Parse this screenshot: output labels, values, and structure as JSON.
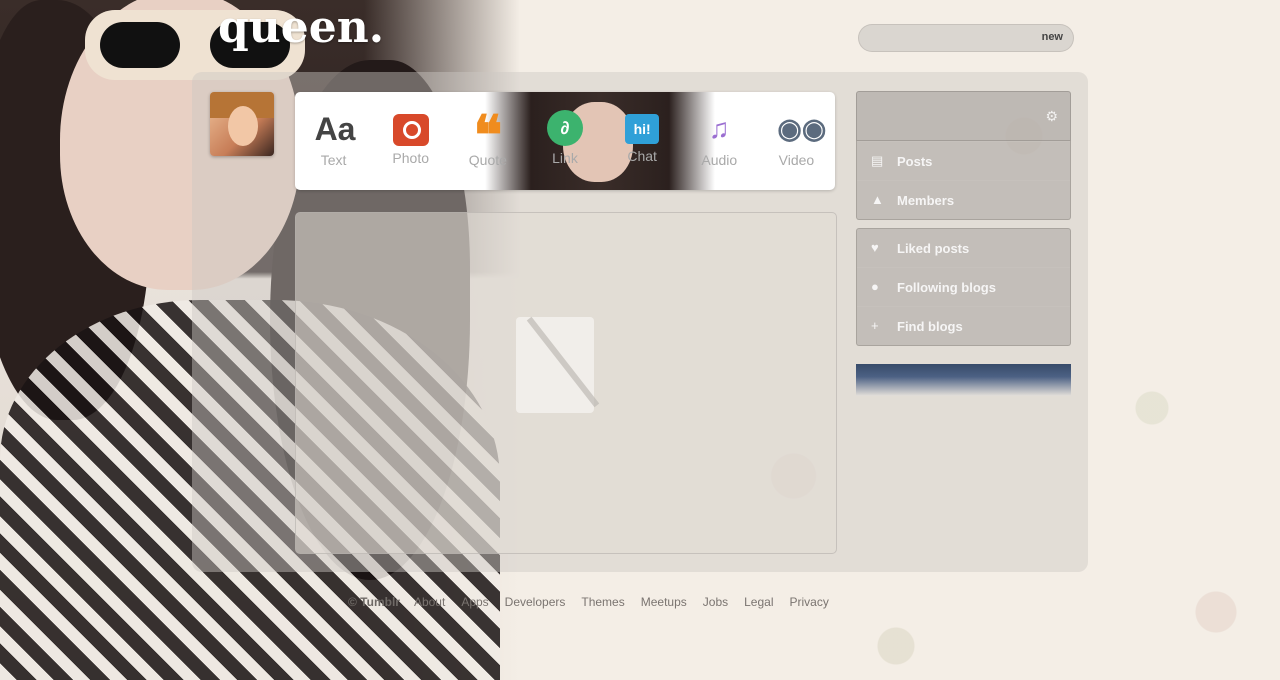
{
  "blog": {
    "title": "queen."
  },
  "search": {
    "placeholder": "",
    "new_label": "new"
  },
  "post_types": [
    {
      "label": "Text",
      "icon": "Aa",
      "icon_name": "text-icon"
    },
    {
      "label": "Photo",
      "icon": "",
      "icon_name": "camera-icon"
    },
    {
      "label": "Quote",
      "icon": "❝",
      "icon_name": "quote-icon"
    },
    {
      "label": "Link",
      "icon": "∂",
      "icon_name": "link-icon"
    },
    {
      "label": "Chat",
      "icon": "hi!",
      "icon_name": "chat-icon"
    },
    {
      "label": "Audio",
      "icon": "♫",
      "icon_name": "headphones-icon"
    },
    {
      "label": "Video",
      "icon": "◉◉",
      "icon_name": "video-camera-icon"
    }
  ],
  "sidebar": {
    "blog_name": "",
    "blog_url": "",
    "primary_items": [
      {
        "label": "Posts",
        "icon": "▤",
        "count": ""
      },
      {
        "label": "Members",
        "icon": "▲",
        "count": ""
      }
    ],
    "caption": "",
    "secondary_items": [
      {
        "label": "Liked posts",
        "icon": "♥",
        "count": ""
      },
      {
        "label": "Following blogs",
        "icon": "●",
        "count": ""
      },
      {
        "label": "Find blogs",
        "icon": "+",
        "count": ""
      }
    ]
  },
  "footer": {
    "copyright": "© Tumblr",
    "links": [
      "About",
      "Apps",
      "Developers",
      "Themes",
      "Meetups",
      "Jobs",
      "Legal",
      "Privacy"
    ]
  },
  "colors": {
    "photo_red": "#d8492a",
    "quote_orange": "#f08c1e",
    "link_green": "#3cb36e",
    "chat_blue": "#2fa0d8",
    "audio_purple": "#9b6fd1",
    "video_slate": "#5c6b7e"
  }
}
